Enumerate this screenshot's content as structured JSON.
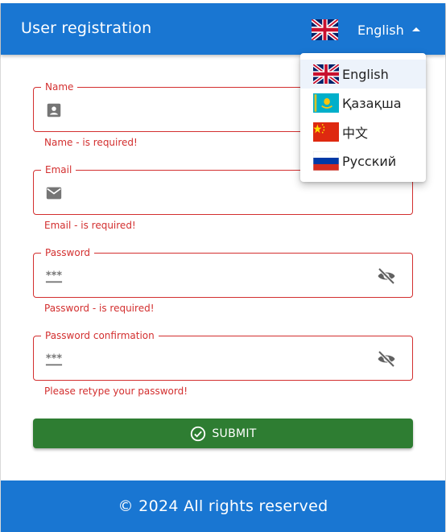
{
  "header": {
    "title": "User registration",
    "current_language": "English",
    "current_flag": "uk-flag-icon"
  },
  "language_menu": {
    "items": [
      {
        "label": "English",
        "icon": "uk-flag-icon",
        "selected": true
      },
      {
        "label": "Қазақша",
        "icon": "kazakhstan-flag-icon",
        "selected": false
      },
      {
        "label": "中文",
        "icon": "china-flag-icon",
        "selected": false
      },
      {
        "label": "Русский",
        "icon": "russia-flag-icon",
        "selected": false
      }
    ]
  },
  "form": {
    "name": {
      "label": "Name",
      "value": "",
      "error": "Name - is required!",
      "icon": "person-card-icon"
    },
    "email": {
      "label": "Email",
      "value": "",
      "error": "Email - is required!",
      "icon": "mail-icon"
    },
    "password": {
      "label": "Password",
      "value": "",
      "error": "Password - is required!",
      "icon": "password-icon",
      "toggle_icon": "visibility-off-icon"
    },
    "password_confirmation": {
      "label": "Password confirmation",
      "value": "",
      "error": "Please retype your password!",
      "icon": "password-icon",
      "toggle_icon": "visibility-off-icon"
    },
    "submit_label": "SUBMIT"
  },
  "footer": {
    "text": "© 2024 All rights reserved"
  },
  "colors": {
    "primary": "#1976d2",
    "error": "#d32f2f",
    "success": "#2e7d32"
  }
}
